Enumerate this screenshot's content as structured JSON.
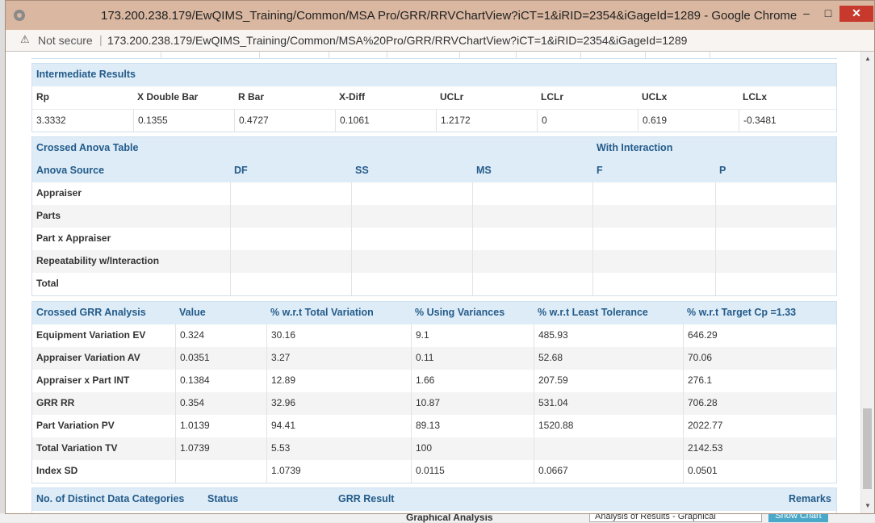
{
  "window": {
    "title": "173.200.238.179/EwQIMS_Training/Common/MSA Pro/GRR/RRVChartView?iCT=1&iRID=2354&iGageId=1289 - Google Chrome",
    "min_symbol": "–",
    "max_symbol": "□",
    "close_symbol": "✕"
  },
  "address": {
    "security_label": "Not secure",
    "separator": "|",
    "url": "173.200.238.179/EwQIMS_Training/Common/MSA%20Pro/GRR/RRVChartView?iCT=1&iRID=2354&iGageId=1289"
  },
  "intermediate": {
    "title": "Intermediate Results",
    "headers": [
      "Rp",
      "X Double Bar",
      "R Bar",
      "X-Diff",
      "UCLr",
      "LCLr",
      "UCLx",
      "LCLx"
    ],
    "values": [
      "3.3332",
      "0.1355",
      "0.4727",
      "0.1061",
      "1.2172",
      "0",
      "0.619",
      "-0.3481"
    ]
  },
  "anova": {
    "title": "Crossed Anova Table",
    "subtitle": "With Interaction",
    "headers": [
      "Anova Source",
      "DF",
      "SS",
      "MS",
      "F",
      "P"
    ],
    "rows": [
      "Appraiser",
      "Parts",
      "Part x Appraiser",
      "Repeatability w/Interaction",
      "Total"
    ]
  },
  "grr": {
    "headers": [
      "Crossed GRR Analysis",
      "Value",
      "% w.r.t Total Variation",
      "% Using Variances",
      "% w.r.t Least Tolerance",
      "% w.r.t Target Cp =1.33"
    ],
    "rows": [
      [
        "Equipment Variation EV",
        "0.324",
        "30.16",
        "9.1",
        "485.93",
        "646.29"
      ],
      [
        "Appraiser Variation AV",
        "0.0351",
        "3.27",
        "0.11",
        "52.68",
        "70.06"
      ],
      [
        "Appraiser x Part INT",
        "0.1384",
        "12.89",
        "1.66",
        "207.59",
        "276.1"
      ],
      [
        "GRR RR",
        "0.354",
        "32.96",
        "10.87",
        "531.04",
        "706.28"
      ],
      [
        "Part Variation PV",
        "1.0139",
        "94.41",
        "89.13",
        "1520.88",
        "2022.77"
      ],
      [
        "Total Variation TV",
        "1.0739",
        "5.53",
        "100",
        "",
        "2142.53"
      ],
      [
        "Index SD",
        "",
        "1.0739",
        "0.0115",
        "0.0667",
        "0.0501"
      ]
    ]
  },
  "result": {
    "headers": [
      "No. of Distinct Data Categories",
      "Status",
      "GRR Result",
      "Remarks"
    ]
  },
  "background": {
    "section_label": "Graphical Analysis",
    "select_value": "Analysis of Results - Graphical",
    "button_label": "Show Chart"
  },
  "colors": {
    "header_bg": "#ddecf7",
    "header_text": "#245b8a",
    "titlebar": "#d9b7a0",
    "close_button": "#c7392c"
  }
}
